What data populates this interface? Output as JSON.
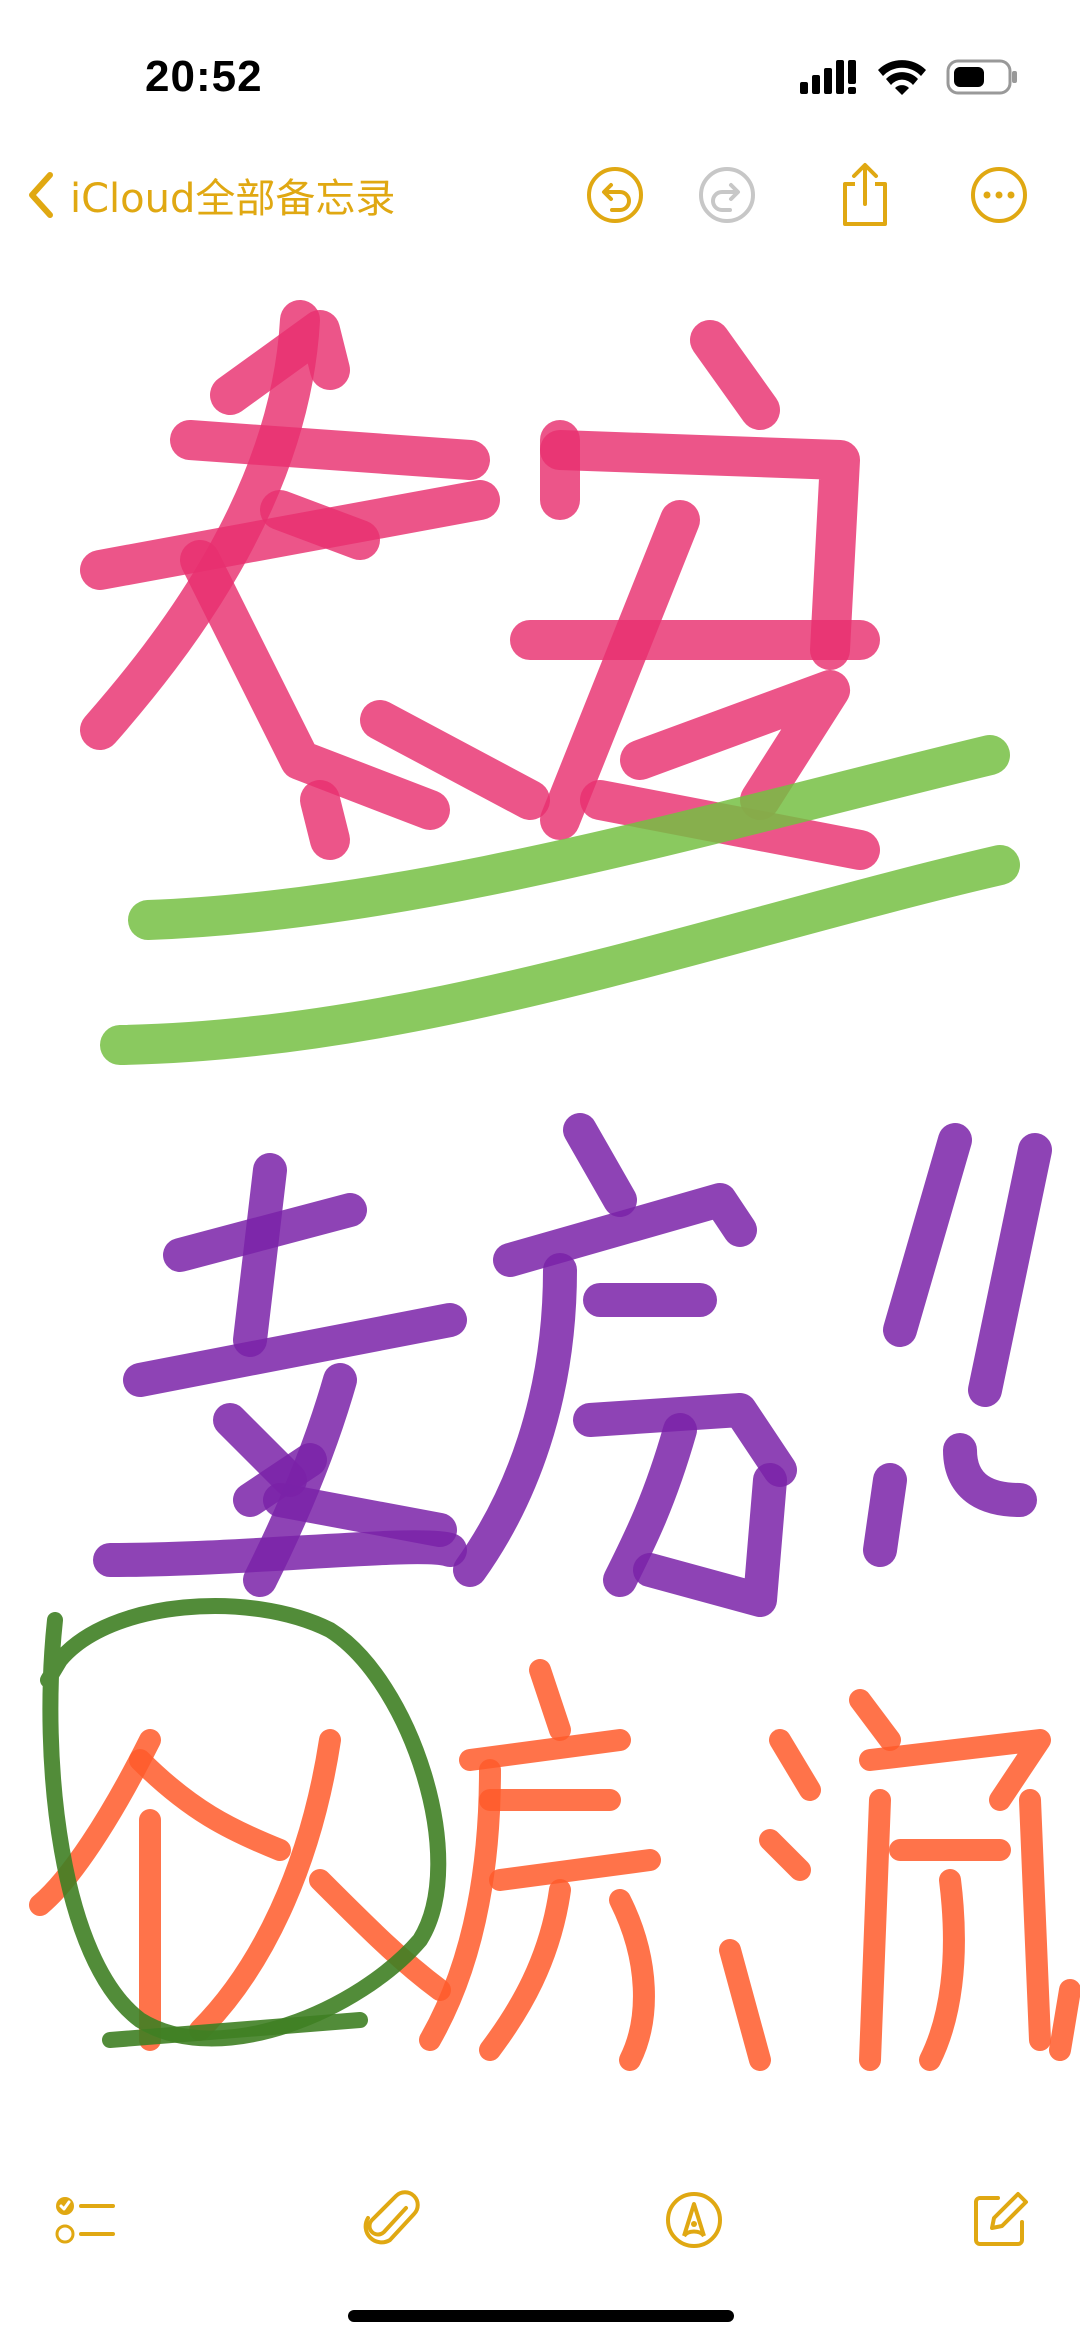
{
  "status_bar": {
    "time": "20:52"
  },
  "nav": {
    "back_label": "iCloud全部备忘录",
    "accent_color": "#e0a812",
    "disabled_color": "#c7c7c7"
  },
  "drawing": {
    "strokes": [
      {
        "text": "泰安",
        "color": "#e8306f"
      },
      {
        "text": "double underline",
        "color": "#76c043"
      },
      {
        "text": "卖房!!",
        "color": "#7a22a8"
      },
      {
        "text": "个人房源",
        "color": "#ff5a2a"
      },
      {
        "text": "circle",
        "color": "#3f7f23"
      }
    ]
  },
  "icons": {
    "back": "chevron-left-icon",
    "undo": "undo-icon",
    "redo": "redo-icon",
    "share": "share-icon",
    "more": "ellipsis-circle-icon",
    "checklist": "checklist-icon",
    "attach": "paperclip-icon",
    "markup": "pen-tip-icon",
    "compose": "compose-icon"
  }
}
